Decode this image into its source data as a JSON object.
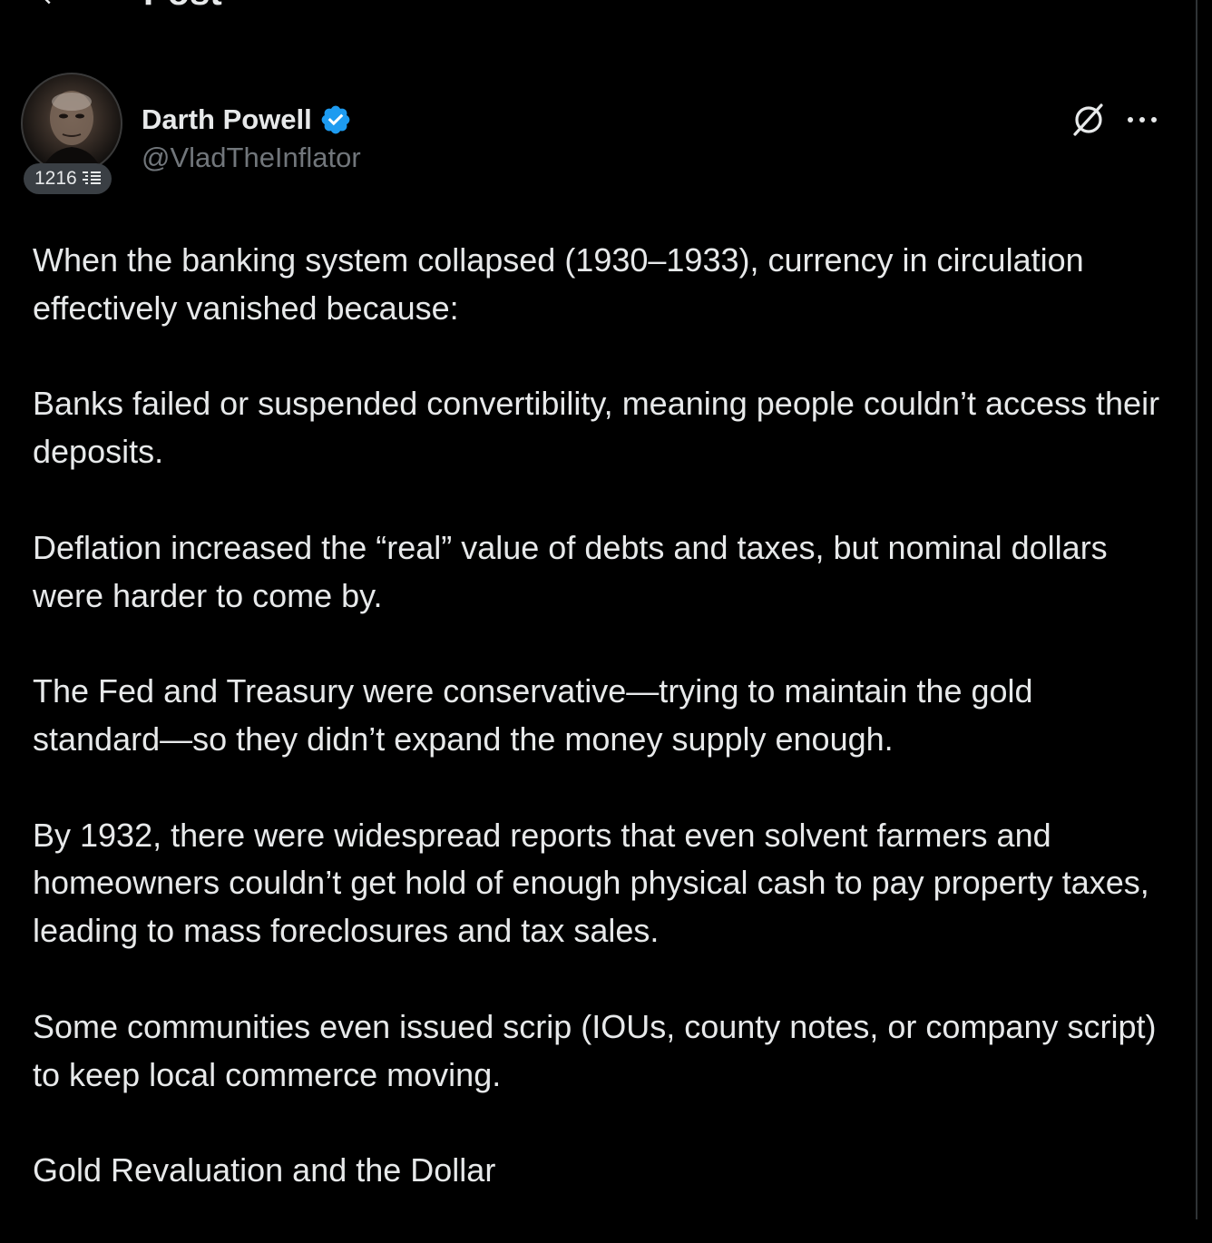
{
  "header": {
    "title": "Post",
    "back_icon": "arrow-left-icon"
  },
  "author": {
    "display_name": "Darth Powell",
    "handle": "@VladTheInflator",
    "verified": true,
    "verified_color": "#1d9bf0",
    "badge_count": "1216",
    "badge_icon": "list-icon"
  },
  "actions": {
    "grok_icon": "grok-icon",
    "more_icon": "more-icon"
  },
  "post": {
    "paragraphs": [
      "When the banking system collapsed (1930–1933), currency in circulation effectively vanished because:",
      "Banks failed or suspended convertibility, meaning people couldn’t access their deposits.",
      "Deflation increased the “real” value of debts and taxes, but nominal dollars were harder to come by.",
      "The Fed and Treasury were conservative—trying to maintain the gold standard—so they didn’t expand the money supply enough.",
      "By 1932, there were widespread reports that even solvent farmers and homeowners couldn’t get hold of enough physical cash to pay property taxes, leading to mass foreclosures and tax sales.",
      "Some communities even issued scrip (IOUs, county notes, or company script) to keep local commerce moving.",
      "Gold Revaluation and the Dollar"
    ]
  },
  "colors": {
    "background": "#000000",
    "text_primary": "#e7e9ea",
    "text_secondary": "#71767b",
    "accent": "#1d9bf0"
  }
}
